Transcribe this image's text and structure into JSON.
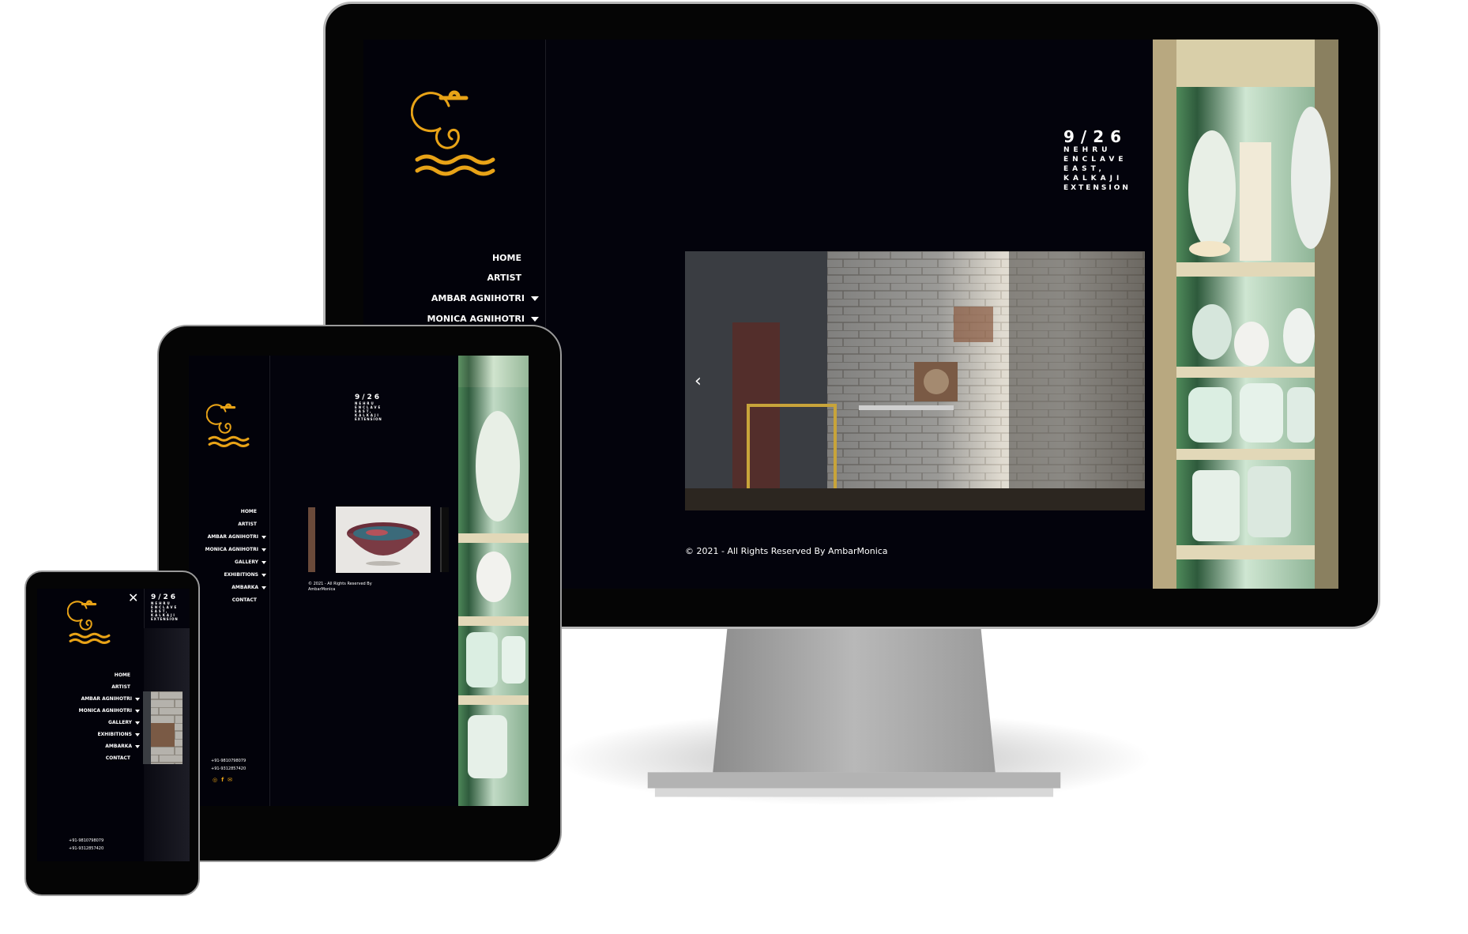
{
  "nav": {
    "home": "HOME",
    "artist": "ARTIST",
    "ambar": "AMBAR AGNIHOTRI",
    "monica": "MONICA AGNIHOTRI",
    "gallery": "GALLERY",
    "exhibitions": "EXHIBITIONS",
    "ambarka": "AMBARKA",
    "contact": "CONTACT"
  },
  "address": {
    "number": "9/26",
    "line1": "NEHRU",
    "line2": "ENCLAVE",
    "line3": "EAST,",
    "line4": "KALKAJI",
    "line5": "EXTENSION"
  },
  "footer": {
    "copyright": "© 2021 - All Rights Reserved By AmbarMonica",
    "copyright_part1": "© 2021 - All Rights Reserved By",
    "copyright_part2": "AmbarMonica",
    "phone1": "+91-9810798079",
    "phone2": "+91-9312857420"
  },
  "icons": {
    "logo": "swirl-logo-icon",
    "prev": "chevron-left-icon",
    "close": "close-icon",
    "social": [
      "instagram-icon",
      "facebook-icon",
      "mail-icon"
    ]
  },
  "colors": {
    "background": "#03030c",
    "accent": "#e8a317",
    "text": "#ffffff"
  }
}
